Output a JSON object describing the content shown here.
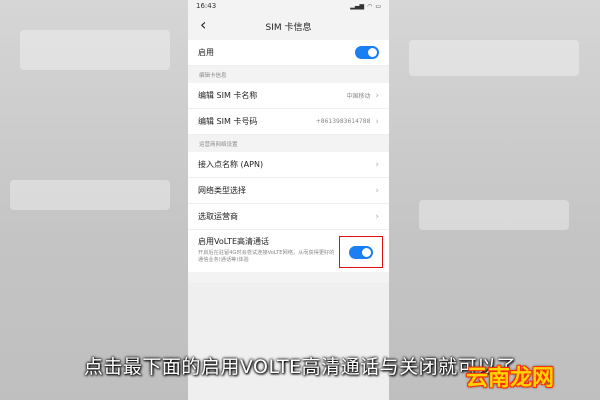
{
  "status_bar": {
    "time": "16:43"
  },
  "header": {
    "title": "SIM 卡信息"
  },
  "enable_row": {
    "label": "启用",
    "enabled": true
  },
  "section_edit": {
    "label": "编辑卡信息"
  },
  "edit_name": {
    "label": "编辑 SIM 卡名称",
    "value": "中国移动"
  },
  "edit_number": {
    "label": "编辑 SIM 卡号码",
    "value": "+8613983614788"
  },
  "section_network": {
    "label": "运营商网络设置"
  },
  "apn": {
    "label": "接入点名称 (APN)"
  },
  "network_type": {
    "label": "网络类型选择"
  },
  "carrier": {
    "label": "选取运营商"
  },
  "volte": {
    "title": "启用VoLTE高清通话",
    "description": "开启后在驻留4G时会尝试连接VoLTE网络，从而获得更好的通信业务(通话等)体验",
    "enabled": true
  },
  "caption": "点击最下面的启用VOLTE高清通话与关闭就可以了",
  "watermark": "云南龙网",
  "colors": {
    "accent": "#1a7ff2",
    "highlight_box": "#e01010"
  }
}
